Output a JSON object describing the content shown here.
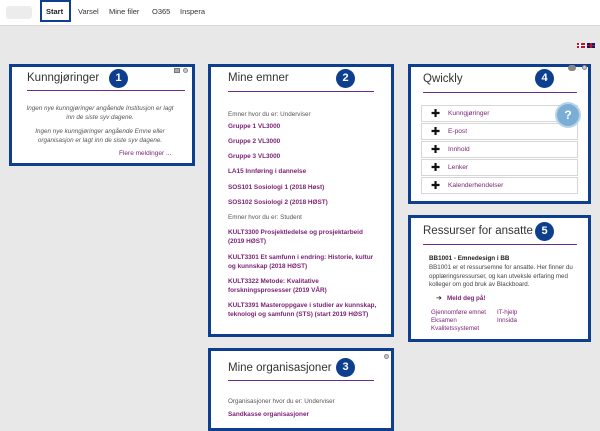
{
  "nav": {
    "tabs": [
      {
        "label": "Start",
        "active": true
      },
      {
        "label": "Varsel"
      },
      {
        "label": "Mine filer"
      },
      {
        "label": "O365"
      },
      {
        "label": "Inspera"
      }
    ]
  },
  "badges": [
    "1",
    "2",
    "3",
    "4",
    "5"
  ],
  "kunngjoringer": {
    "title": "Kunngjøringer",
    "note1": "Ingen nye kunngjøringer angående Institusjon er lagt inn de siste syv dagene.",
    "note2": "Ingen nye kunngjøringer angående Emne eller organisasjon er lagt inn de siste syv dagene.",
    "more_link": "Flere meldinger ..."
  },
  "mine_emner": {
    "title": "Mine emner",
    "role_teacher": "Emner hvor du er: Underviser",
    "teacher_courses": [
      "Gruppe 1 VL3000",
      "Gruppe 2 VL3000",
      "Gruppe 3 VL3000",
      "LA15 Innføring i dannelse",
      "SOS101 Sosiologi 1 (2018 Høst)",
      "SOS102 Sosiologi 2 (2018 HØST)"
    ],
    "role_student": "Emner hvor du er: Student",
    "student_courses": [
      "KULT3300 Prosjektledelse og prosjektarbeid (2019 HØST)",
      "KULT3301 Et samfunn i endring: Historie, kultur og kunnskap (2018 HØST)",
      "KULT3322 Metode: Kvalitative forskningsprosesser (2019 VÅR)",
      "KULT3391 Masteroppgave i studier av kunnskap, teknologi og samfunn (STS) (start 2019 HØST)"
    ]
  },
  "mine_organisasjoner": {
    "title": "Mine organisasjoner",
    "role": "Organisasjoner hvor du er: Underviser",
    "orgs": [
      "Sandkasse organisasjoner"
    ]
  },
  "qwickly": {
    "title": "Qwickly",
    "items": [
      "Kunngjøringer",
      "E-post",
      "Innhold",
      "Lenker",
      "Kalenderhendelser"
    ]
  },
  "ressurser": {
    "title": "Ressurser for ansatte",
    "heading": "BB1001 - Emnedesign i BB",
    "desc": "BB1001 er et ressursemne for ansatte. Her finner du opplæringsressurser, og kan utveksle erfaring med kolleger om god bruk av Blackboard.",
    "signup": "Meld deg på!",
    "links_left": [
      "Gjennomføre emnet",
      "Eksamen",
      "Kvalitetssystemet"
    ],
    "links_right": [
      "IT-hjelp",
      "Innsida"
    ]
  },
  "colors": {
    "frame": "#0d3f8e",
    "link": "#7a1f74",
    "help": "#7aaed4"
  }
}
